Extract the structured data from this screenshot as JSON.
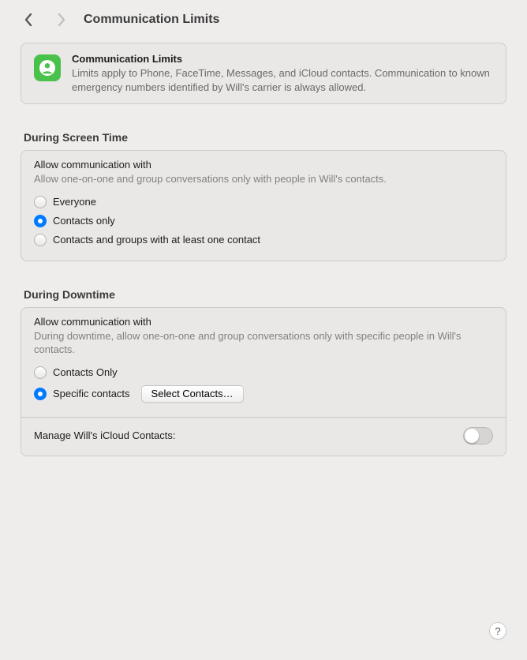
{
  "header": {
    "title": "Communication Limits"
  },
  "intro": {
    "title": "Communication Limits",
    "desc": "Limits apply to Phone, FaceTime, Messages, and iCloud contacts. Communication to known emergency numbers identified by Will's carrier is always allowed."
  },
  "screentime": {
    "section_title": "During Screen Time",
    "group_title": "Allow communication with",
    "group_desc": "Allow one-on-one and group conversations only with people in Will's contacts.",
    "options": {
      "everyone": "Everyone",
      "contacts_only": "Contacts only",
      "groups": "Contacts and groups with at least one contact"
    },
    "selected": "contacts_only"
  },
  "downtime": {
    "section_title": "During Downtime",
    "group_title": "Allow communication with",
    "group_desc": "During downtime, allow one-on-one and group conversations only with specific people in Will's contacts.",
    "options": {
      "contacts_only": "Contacts Only",
      "specific": "Specific contacts"
    },
    "selected": "specific",
    "select_button": "Select Contacts…",
    "manage_label": "Manage Will's iCloud Contacts:",
    "manage_on": false
  },
  "help_glyph": "?"
}
